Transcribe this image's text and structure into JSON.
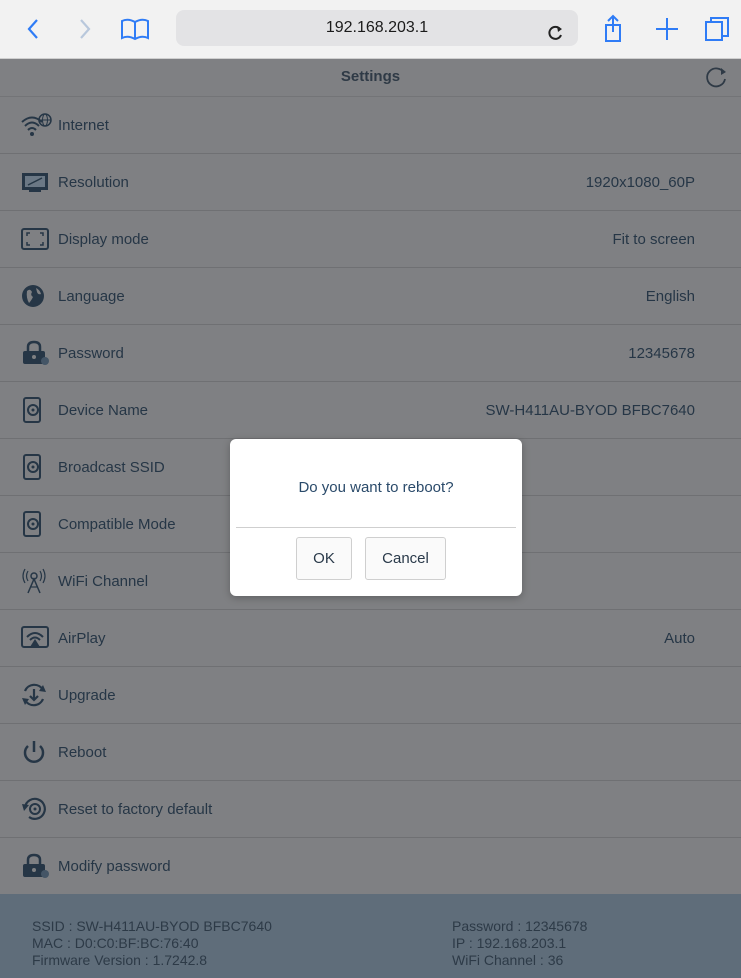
{
  "browser": {
    "url": "192.168.203.1",
    "back_icon": "chevron-left-icon",
    "forward_icon": "chevron-right-icon",
    "bookmarks_icon": "book-icon",
    "reload_icon": "reload-icon",
    "share_icon": "share-icon",
    "new_tab_icon": "plus-icon",
    "tabs_icon": "tabs-icon",
    "accent_color": "#2f7cf6"
  },
  "page": {
    "title": "Settings",
    "refresh_icon": "refresh-icon"
  },
  "settings": {
    "items": [
      {
        "label": "Internet",
        "value": "",
        "icon": "wifi-globe-icon"
      },
      {
        "label": "Resolution",
        "value": "1920x1080_60P",
        "icon": "monitor-icon"
      },
      {
        "label": "Display mode",
        "value": "Fit to screen",
        "icon": "fullscreen-icon"
      },
      {
        "label": "Language",
        "value": "English",
        "icon": "globe-icon"
      },
      {
        "label": "Password",
        "value": "12345678",
        "icon": "lock-icon"
      },
      {
        "label": "Device Name",
        "value": "SW-H411AU-BYOD BFBC7640",
        "icon": "phone-gear-icon"
      },
      {
        "label": "Broadcast SSID",
        "value": "",
        "icon": "phone-gear-icon"
      },
      {
        "label": "Compatible Mode",
        "value": "",
        "icon": "phone-gear-icon"
      },
      {
        "label": "WiFi Channel",
        "value": "",
        "icon": "antenna-icon"
      },
      {
        "label": "AirPlay",
        "value": "Auto",
        "icon": "airplay-icon"
      },
      {
        "label": "Upgrade",
        "value": "",
        "icon": "upgrade-icon"
      },
      {
        "label": "Reboot",
        "value": "",
        "icon": "power-icon"
      },
      {
        "label": "Reset to factory default",
        "value": "",
        "icon": "factory-reset-icon"
      },
      {
        "label": "Modify password",
        "value": "",
        "icon": "lock-icon"
      }
    ]
  },
  "footer": {
    "ssid": "SSID : SW-H411AU-BYOD BFBC7640",
    "mac": "MAC : D0:C0:BF:BC:76:40",
    "firmware": "Firmware Version : 1.7242.8",
    "password": "Password : 12345678",
    "ip": "IP : 192.168.203.1",
    "wifi_channel": "WiFi Channel : 36"
  },
  "dialog": {
    "message": "Do you want to reboot?",
    "ok_label": "OK",
    "cancel_label": "Cancel"
  },
  "colors": {
    "overlay_background": "#7f8083",
    "footer_background": "#5f6d7a",
    "text": "#263646"
  }
}
